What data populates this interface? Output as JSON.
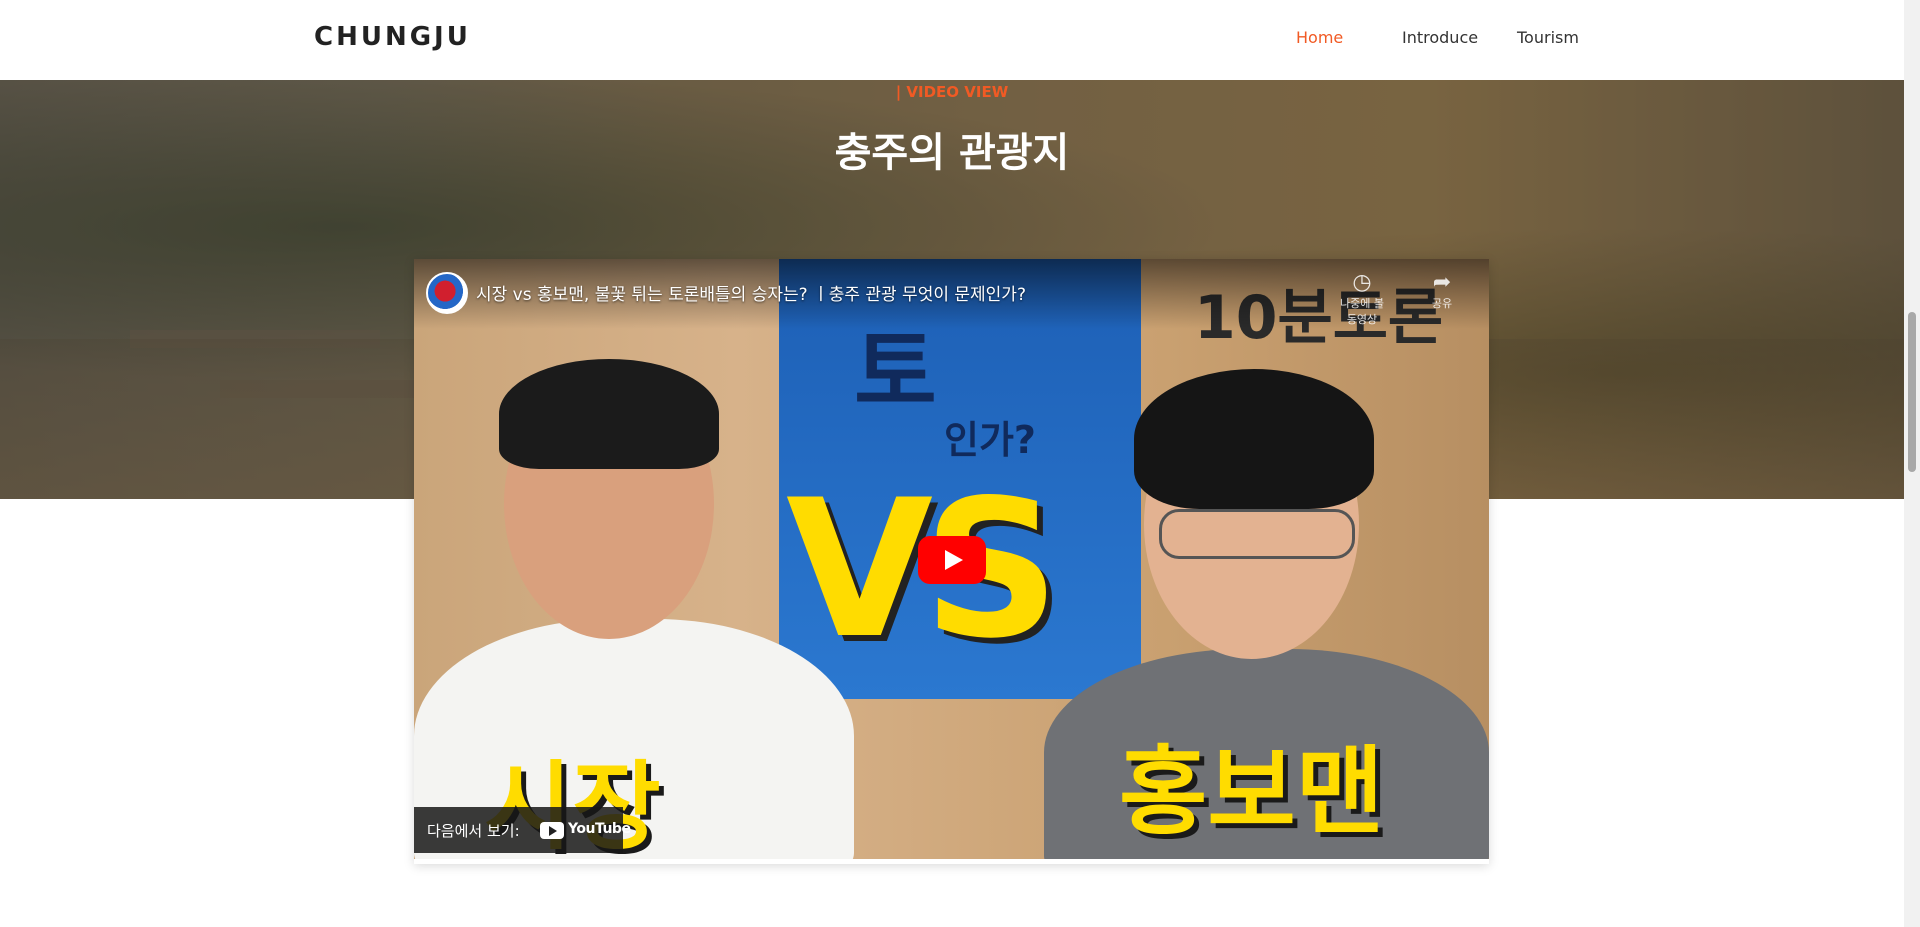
{
  "brand": "CHUNGJU",
  "nav": [
    {
      "label": "Home",
      "active": true
    },
    {
      "label": "Introduce",
      "active": false
    },
    {
      "label": "Tourism",
      "active": false
    }
  ],
  "hero": {
    "subtitle": "| VIDEO VIEW",
    "title": "충주의 관광지"
  },
  "video": {
    "title": "시장 vs 홍보맨, 불꽃 튀는 토론배틀의 승자는? ㅣ충주 관광 무엇이 문제인가?",
    "thumbnail_banner_text": "토",
    "thumbnail_question": "인가?",
    "thumbnail_vs": "VS",
    "thumbnail_corner_text": "10분토론",
    "thumbnail_left_label": "시장",
    "thumbnail_right_label": "홍보맨",
    "watch_later": "나중에 볼 동영상",
    "share": "공유",
    "watch_on": "다음에서 보기:",
    "youtube": "YouTube"
  },
  "colors": {
    "accent": "#f15a24",
    "play_red": "#ff0000",
    "thumbnail_yellow": "#ffdc00"
  }
}
